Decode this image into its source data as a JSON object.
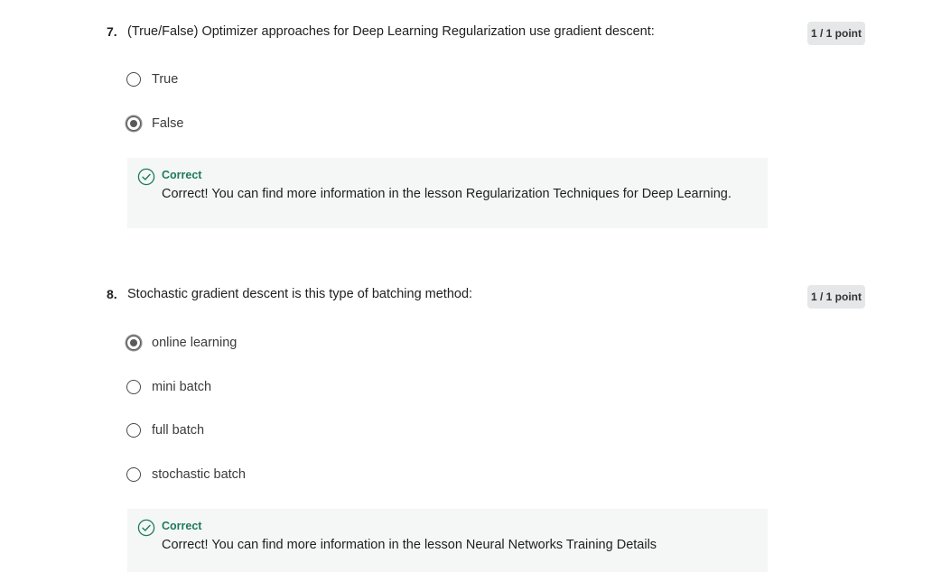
{
  "questions": [
    {
      "number": "7.",
      "text": "(True/False) Optimizer approaches for Deep Learning Regularization use gradient descent:",
      "points": "1 / 1 point",
      "options": [
        {
          "label": "True",
          "selected": false
        },
        {
          "label": "False",
          "selected": true
        }
      ],
      "feedback": {
        "icon": "check-circle-icon",
        "title": "Correct",
        "text": "Correct! You can find more information in the lesson Regularization Techniques for Deep Learning."
      }
    },
    {
      "number": "8.",
      "text": "Stochastic gradient descent is this type of batching method:",
      "points": "1 / 1 point",
      "options": [
        {
          "label": "online learning",
          "selected": true
        },
        {
          "label": "mini batch",
          "selected": false
        },
        {
          "label": "full batch",
          "selected": false
        },
        {
          "label": "stochastic batch",
          "selected": false
        }
      ],
      "feedback": {
        "icon": "check-circle-icon",
        "title": "Correct",
        "text": "Correct! You can find more information in the lesson Neural Networks Training Details"
      }
    }
  ],
  "colors": {
    "correct_green": "#1f7a5a",
    "feedback_bg": "#f4f7f6",
    "badge_bg": "#e5e7e8"
  }
}
